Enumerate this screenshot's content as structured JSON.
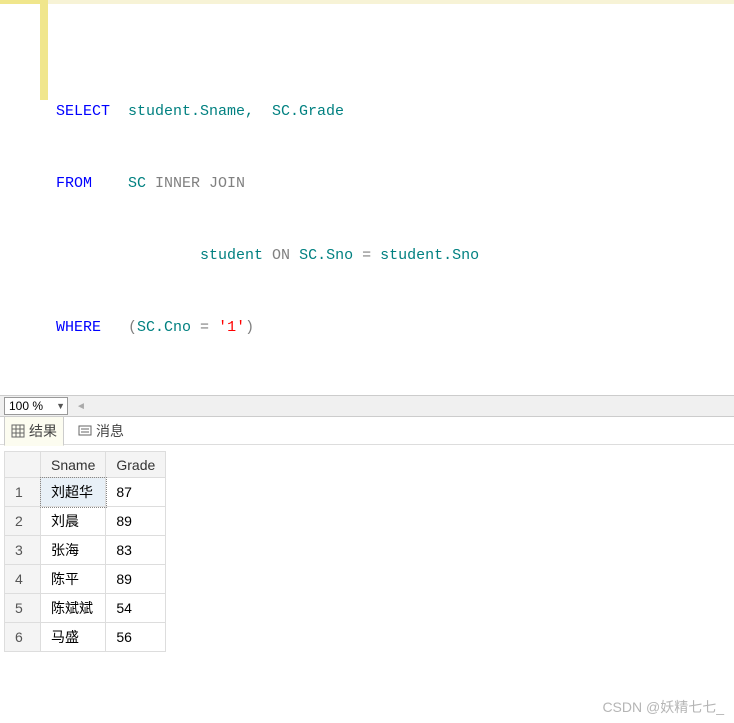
{
  "sql": {
    "select_kw": "SELECT",
    "select_cols": "  student.Sname,  SC.Grade",
    "from_kw": "FROM",
    "from_text1": "    SC ",
    "inner_join": "INNER JOIN",
    "from_text2": "                student ",
    "on_kw": "ON",
    "on_text": " SC.Sno ",
    "eq1": "=",
    "on_text2": " student.Sno",
    "where_kw": "WHERE",
    "where_open": "   (",
    "where_col": "SC.Cno ",
    "eq2": "=",
    "where_space": " ",
    "where_val": "'1'",
    "where_close": ")"
  },
  "zoom": {
    "value": "100 %"
  },
  "tabs": {
    "results": "结果",
    "messages": "消息"
  },
  "grid": {
    "headers": [
      "Sname",
      "Grade"
    ],
    "rows": [
      {
        "num": "1",
        "sname": "刘超华",
        "grade": "87"
      },
      {
        "num": "2",
        "sname": "刘晨",
        "grade": "89"
      },
      {
        "num": "3",
        "sname": "张海",
        "grade": "83"
      },
      {
        "num": "4",
        "sname": "陈平",
        "grade": "89"
      },
      {
        "num": "5",
        "sname": "陈斌斌",
        "grade": "54"
      },
      {
        "num": "6",
        "sname": "马盛",
        "grade": "56"
      }
    ]
  },
  "watermark": "CSDN @妖精七七_"
}
